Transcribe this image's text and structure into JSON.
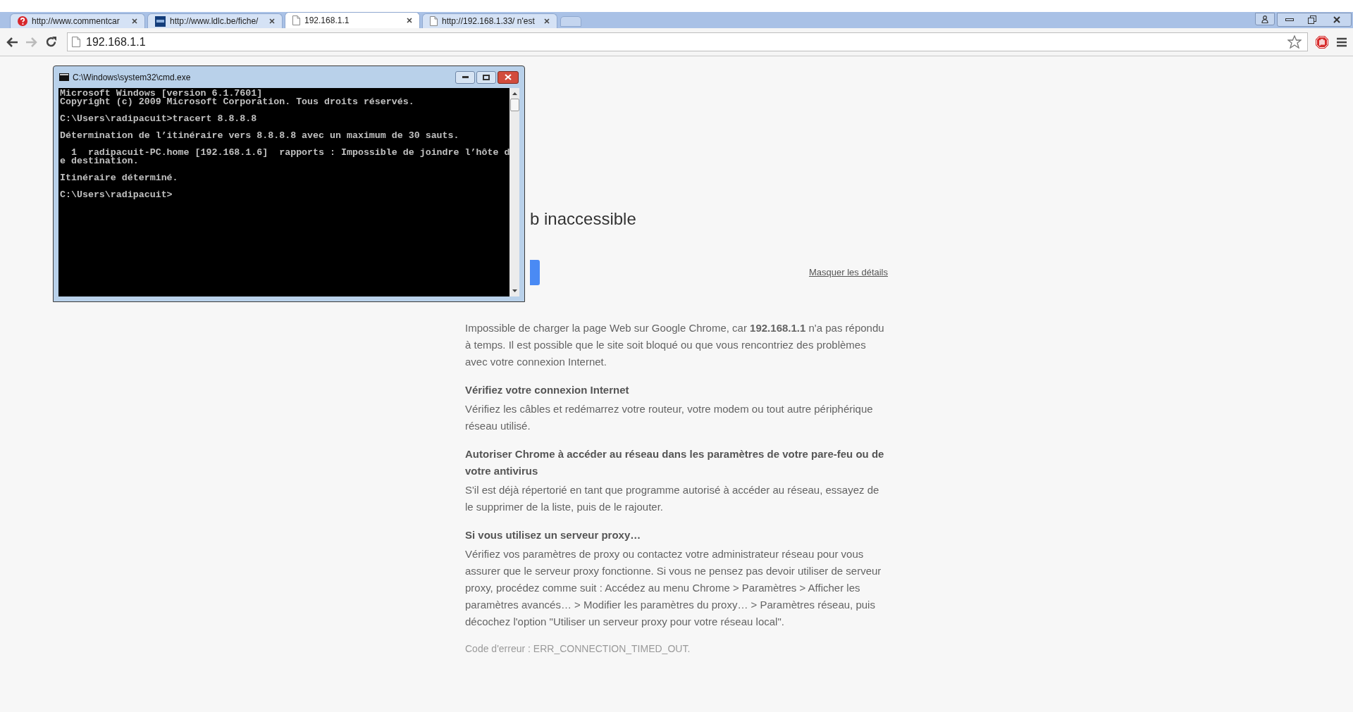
{
  "tabs": [
    {
      "kind": "question",
      "title": "http://www.commentcar",
      "selected": false
    },
    {
      "kind": "square",
      "title": "http://www.ldlc.be/fiche/",
      "selected": false
    },
    {
      "kind": "page",
      "title": "192.168.1.1",
      "selected": true
    },
    {
      "kind": "page",
      "title": "http://192.168.1.33/ n'est",
      "selected": false
    }
  ],
  "address": "192.168.1.1",
  "console_window": {
    "title": "C:\\Windows\\system32\\cmd.exe",
    "blocks": [
      [
        "Microsoft Windows [version 6.1.7601]",
        "Copyright (c) 2009 Microsoft Corporation. Tous droits réservés."
      ],
      [
        "C:\\Users\\radipacuit>tracert 8.8.8.8"
      ],
      [
        "Détermination de l’itinéraire vers 8.8.8.8 avec un maximum de 30 sauts."
      ],
      [
        "  1  radipacuit-PC.home [192.168.1.6]  rapports : Impossible de joindre l’hôte d",
        "e destination."
      ],
      [
        "Itinéraire déterminé."
      ],
      [
        "C:\\Users\\radipacuit>"
      ]
    ]
  },
  "error_page": {
    "heading": "b inaccessible",
    "details_link": "Masquer les détails",
    "intro": "Impossible de charger la page Web sur Google Chrome, car **192.168.1.1** n'a pas répondu à temps. Il est possible que le site soit bloqué ou que vous rencontriez des problèmes avec votre connexion Internet.",
    "sections": [
      {
        "title": "Vérifiez votre connexion Internet",
        "body": "Vérifiez les câbles et redémarrez votre routeur, votre modem ou tout autre périphérique réseau utilisé."
      },
      {
        "title": "Autoriser Chrome à accéder au réseau dans les paramètres de votre pare-feu ou de votre antivirus",
        "body": "S'il est déjà répertorié en tant que programme autorisé à accéder au réseau, essayez de le supprimer de la liste, puis de le rajouter."
      },
      {
        "title": "Si vous utilisez un serveur proxy…",
        "body": "Vérifiez vos paramètres de proxy ou contactez votre administrateur réseau pour vous assurer que le serveur proxy fonctionne. Si vous ne pensez pas devoir utiliser de serveur proxy, procédez comme suit : Accédez au menu Chrome > Paramètres > Afficher les paramètres avancés… > Modifier les paramètres du proxy… > Paramètres réseau, puis décochez l'option \"Utiliser un serveur proxy pour votre réseau local\"."
      }
    ],
    "error_code": "Code d'erreur : ERR_CONNECTION_TIMED_OUT."
  }
}
